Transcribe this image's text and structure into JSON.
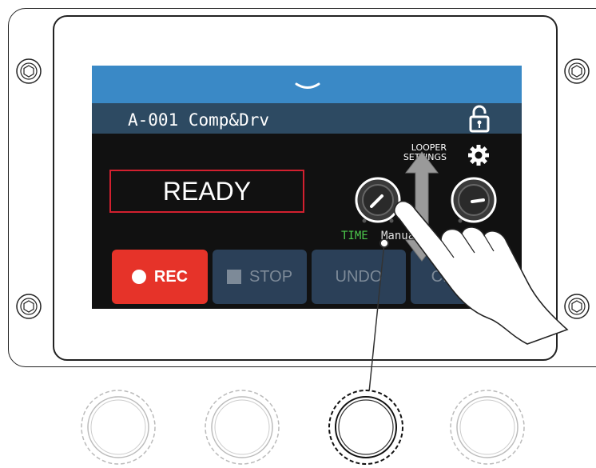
{
  "screen": {
    "patch_title": "A-001 Comp&Drv",
    "status": "READY",
    "looper_settings_line1": "LOOPER",
    "looper_settings_line2": "SETTINGS",
    "knob1_label": "TIME",
    "knob2_label": "Manual",
    "buttons": {
      "rec": "REC",
      "stop": "STOP",
      "undo": "UNDO",
      "clear": "CLEAR"
    }
  },
  "colors": {
    "topbar": "#3a89c6",
    "titlebar": "#2d4a62",
    "rec_button": "#e63329",
    "status_border": "#d2202f",
    "time_label": "#4cc84c"
  },
  "icons": [
    "chevron-down-icon",
    "lock-icon",
    "gear-icon",
    "screw-icon",
    "hand-pointer-icon",
    "up-down-arrow-icon"
  ]
}
